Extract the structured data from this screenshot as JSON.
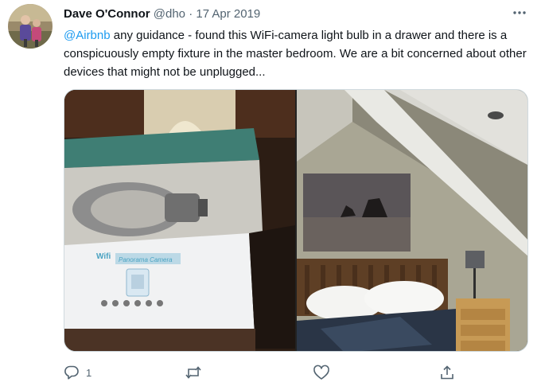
{
  "tweet": {
    "author": {
      "name": "Dave O'Connor",
      "handle": "@dho",
      "separator": "·",
      "date": "17 Apr 2019"
    },
    "text": {
      "mention": "@Airbnb",
      "body": " any guidance - found this WiFi-camera light bulb in a drawer and there is a conspicuously empty fixture in the master bedroom. We are a bit concerned about other devices that might not be unplugged..."
    },
    "media": {
      "left_photo": {
        "box_brand": "Wifi",
        "box_label": "Panorama Camera"
      }
    },
    "actions": {
      "reply_count": "1"
    }
  },
  "colors": {
    "link": "#1d9bf0",
    "secondary_text": "#536471",
    "icon": "#536471",
    "box_teal": "#3f7e74"
  },
  "icons": [
    "more-icon",
    "reply-icon",
    "retweet-icon",
    "like-icon",
    "share-icon"
  ]
}
